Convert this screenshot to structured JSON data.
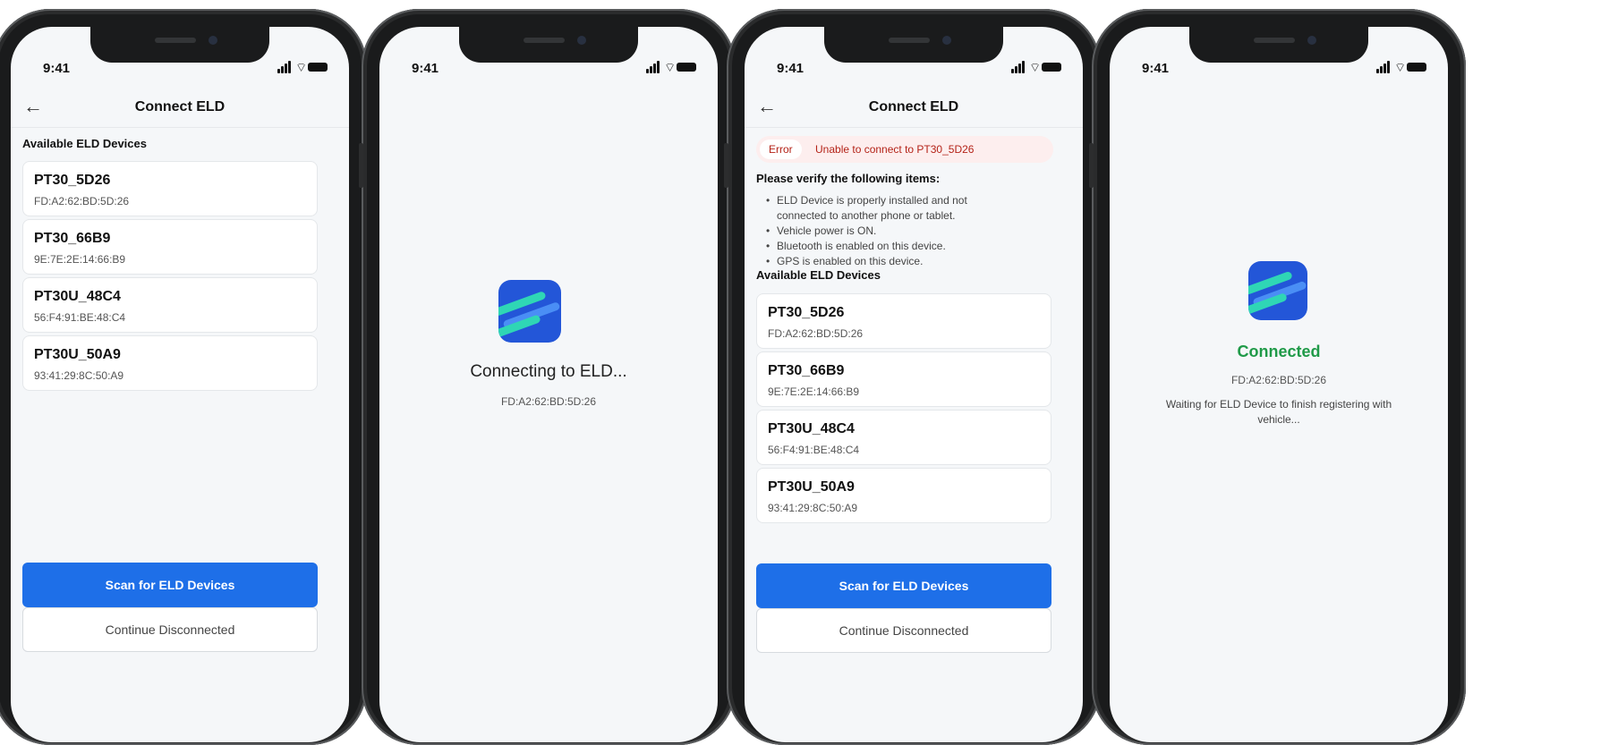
{
  "status_time": "9:41",
  "screen1": {
    "title": "Connect ELD",
    "section": "Available ELD Devices",
    "devices": [
      {
        "name": "PT30_5D26",
        "mac": "FD:A2:62:BD:5D:26"
      },
      {
        "name": "PT30_66B9",
        "mac": "9E:7E:2E:14:66:B9"
      },
      {
        "name": "PT30U_48C4",
        "mac": "56:F4:91:BE:48:C4"
      },
      {
        "name": "PT30U_50A9",
        "mac": "93:41:29:8C:50:A9"
      }
    ],
    "scan_label": "Scan for ELD Devices",
    "continue_label": "Continue Disconnected"
  },
  "screen2": {
    "message": "Connecting to ELD...",
    "mac": "FD:A2:62:BD:5D:26"
  },
  "screen3": {
    "title": "Connect ELD",
    "error_tag": "Error",
    "error_message": "Unable to connect to PT30_5D26",
    "verify_heading": "Please verify the following items:",
    "checklist": [
      "ELD Device is properly installed and not connected to another phone or tablet.",
      "Vehicle power is ON.",
      "Bluetooth is enabled on this device.",
      "GPS is enabled on this device."
    ],
    "section": "Available ELD Devices",
    "devices": [
      {
        "name": "PT30_5D26",
        "mac": "FD:A2:62:BD:5D:26"
      },
      {
        "name": "PT30_66B9",
        "mac": "9E:7E:2E:14:66:B9"
      },
      {
        "name": "PT30U_48C4",
        "mac": "56:F4:91:BE:48:C4"
      },
      {
        "name": "PT30U_50A9",
        "mac": "93:41:29:8C:50:A9"
      }
    ],
    "scan_label": "Scan for ELD Devices",
    "continue_label": "Continue Disconnected"
  },
  "screen4": {
    "status": "Connected",
    "mac": "FD:A2:62:BD:5D:26",
    "waiting": "Waiting for ELD Device to finish registering with vehicle..."
  },
  "colors": {
    "accent": "#1e6fe8",
    "success": "#1f9a48",
    "error": "#b42318",
    "logo_blue": "#2356d8",
    "logo_teal": "#2fd6b5"
  },
  "icons": [
    "back-arrow-icon",
    "signal-icon",
    "wifi-icon",
    "battery-icon",
    "eld-logo-icon"
  ]
}
